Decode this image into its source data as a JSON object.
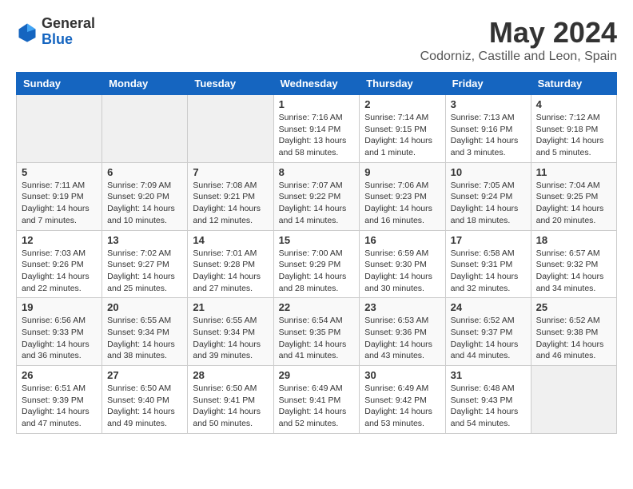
{
  "logo": {
    "general": "General",
    "blue": "Blue"
  },
  "title": "May 2024",
  "subtitle": "Codorniz, Castille and Leon, Spain",
  "days_of_week": [
    "Sunday",
    "Monday",
    "Tuesday",
    "Wednesday",
    "Thursday",
    "Friday",
    "Saturday"
  ],
  "weeks": [
    [
      {
        "day": "",
        "sunrise": "",
        "sunset": "",
        "daylight": "",
        "empty": true
      },
      {
        "day": "",
        "sunrise": "",
        "sunset": "",
        "daylight": "",
        "empty": true
      },
      {
        "day": "",
        "sunrise": "",
        "sunset": "",
        "daylight": "",
        "empty": true
      },
      {
        "day": "1",
        "sunrise": "Sunrise: 7:16 AM",
        "sunset": "Sunset: 9:14 PM",
        "daylight": "Daylight: 13 hours and 58 minutes."
      },
      {
        "day": "2",
        "sunrise": "Sunrise: 7:14 AM",
        "sunset": "Sunset: 9:15 PM",
        "daylight": "Daylight: 14 hours and 1 minute."
      },
      {
        "day": "3",
        "sunrise": "Sunrise: 7:13 AM",
        "sunset": "Sunset: 9:16 PM",
        "daylight": "Daylight: 14 hours and 3 minutes."
      },
      {
        "day": "4",
        "sunrise": "Sunrise: 7:12 AM",
        "sunset": "Sunset: 9:18 PM",
        "daylight": "Daylight: 14 hours and 5 minutes."
      }
    ],
    [
      {
        "day": "5",
        "sunrise": "Sunrise: 7:11 AM",
        "sunset": "Sunset: 9:19 PM",
        "daylight": "Daylight: 14 hours and 7 minutes."
      },
      {
        "day": "6",
        "sunrise": "Sunrise: 7:09 AM",
        "sunset": "Sunset: 9:20 PM",
        "daylight": "Daylight: 14 hours and 10 minutes."
      },
      {
        "day": "7",
        "sunrise": "Sunrise: 7:08 AM",
        "sunset": "Sunset: 9:21 PM",
        "daylight": "Daylight: 14 hours and 12 minutes."
      },
      {
        "day": "8",
        "sunrise": "Sunrise: 7:07 AM",
        "sunset": "Sunset: 9:22 PM",
        "daylight": "Daylight: 14 hours and 14 minutes."
      },
      {
        "day": "9",
        "sunrise": "Sunrise: 7:06 AM",
        "sunset": "Sunset: 9:23 PM",
        "daylight": "Daylight: 14 hours and 16 minutes."
      },
      {
        "day": "10",
        "sunrise": "Sunrise: 7:05 AM",
        "sunset": "Sunset: 9:24 PM",
        "daylight": "Daylight: 14 hours and 18 minutes."
      },
      {
        "day": "11",
        "sunrise": "Sunrise: 7:04 AM",
        "sunset": "Sunset: 9:25 PM",
        "daylight": "Daylight: 14 hours and 20 minutes."
      }
    ],
    [
      {
        "day": "12",
        "sunrise": "Sunrise: 7:03 AM",
        "sunset": "Sunset: 9:26 PM",
        "daylight": "Daylight: 14 hours and 22 minutes."
      },
      {
        "day": "13",
        "sunrise": "Sunrise: 7:02 AM",
        "sunset": "Sunset: 9:27 PM",
        "daylight": "Daylight: 14 hours and 25 minutes."
      },
      {
        "day": "14",
        "sunrise": "Sunrise: 7:01 AM",
        "sunset": "Sunset: 9:28 PM",
        "daylight": "Daylight: 14 hours and 27 minutes."
      },
      {
        "day": "15",
        "sunrise": "Sunrise: 7:00 AM",
        "sunset": "Sunset: 9:29 PM",
        "daylight": "Daylight: 14 hours and 28 minutes."
      },
      {
        "day": "16",
        "sunrise": "Sunrise: 6:59 AM",
        "sunset": "Sunset: 9:30 PM",
        "daylight": "Daylight: 14 hours and 30 minutes."
      },
      {
        "day": "17",
        "sunrise": "Sunrise: 6:58 AM",
        "sunset": "Sunset: 9:31 PM",
        "daylight": "Daylight: 14 hours and 32 minutes."
      },
      {
        "day": "18",
        "sunrise": "Sunrise: 6:57 AM",
        "sunset": "Sunset: 9:32 PM",
        "daylight": "Daylight: 14 hours and 34 minutes."
      }
    ],
    [
      {
        "day": "19",
        "sunrise": "Sunrise: 6:56 AM",
        "sunset": "Sunset: 9:33 PM",
        "daylight": "Daylight: 14 hours and 36 minutes."
      },
      {
        "day": "20",
        "sunrise": "Sunrise: 6:55 AM",
        "sunset": "Sunset: 9:34 PM",
        "daylight": "Daylight: 14 hours and 38 minutes."
      },
      {
        "day": "21",
        "sunrise": "Sunrise: 6:55 AM",
        "sunset": "Sunset: 9:34 PM",
        "daylight": "Daylight: 14 hours and 39 minutes."
      },
      {
        "day": "22",
        "sunrise": "Sunrise: 6:54 AM",
        "sunset": "Sunset: 9:35 PM",
        "daylight": "Daylight: 14 hours and 41 minutes."
      },
      {
        "day": "23",
        "sunrise": "Sunrise: 6:53 AM",
        "sunset": "Sunset: 9:36 PM",
        "daylight": "Daylight: 14 hours and 43 minutes."
      },
      {
        "day": "24",
        "sunrise": "Sunrise: 6:52 AM",
        "sunset": "Sunset: 9:37 PM",
        "daylight": "Daylight: 14 hours and 44 minutes."
      },
      {
        "day": "25",
        "sunrise": "Sunrise: 6:52 AM",
        "sunset": "Sunset: 9:38 PM",
        "daylight": "Daylight: 14 hours and 46 minutes."
      }
    ],
    [
      {
        "day": "26",
        "sunrise": "Sunrise: 6:51 AM",
        "sunset": "Sunset: 9:39 PM",
        "daylight": "Daylight: 14 hours and 47 minutes."
      },
      {
        "day": "27",
        "sunrise": "Sunrise: 6:50 AM",
        "sunset": "Sunset: 9:40 PM",
        "daylight": "Daylight: 14 hours and 49 minutes."
      },
      {
        "day": "28",
        "sunrise": "Sunrise: 6:50 AM",
        "sunset": "Sunset: 9:41 PM",
        "daylight": "Daylight: 14 hours and 50 minutes."
      },
      {
        "day": "29",
        "sunrise": "Sunrise: 6:49 AM",
        "sunset": "Sunset: 9:41 PM",
        "daylight": "Daylight: 14 hours and 52 minutes."
      },
      {
        "day": "30",
        "sunrise": "Sunrise: 6:49 AM",
        "sunset": "Sunset: 9:42 PM",
        "daylight": "Daylight: 14 hours and 53 minutes."
      },
      {
        "day": "31",
        "sunrise": "Sunrise: 6:48 AM",
        "sunset": "Sunset: 9:43 PM",
        "daylight": "Daylight: 14 hours and 54 minutes."
      },
      {
        "day": "",
        "sunrise": "",
        "sunset": "",
        "daylight": "",
        "empty": true
      }
    ]
  ]
}
